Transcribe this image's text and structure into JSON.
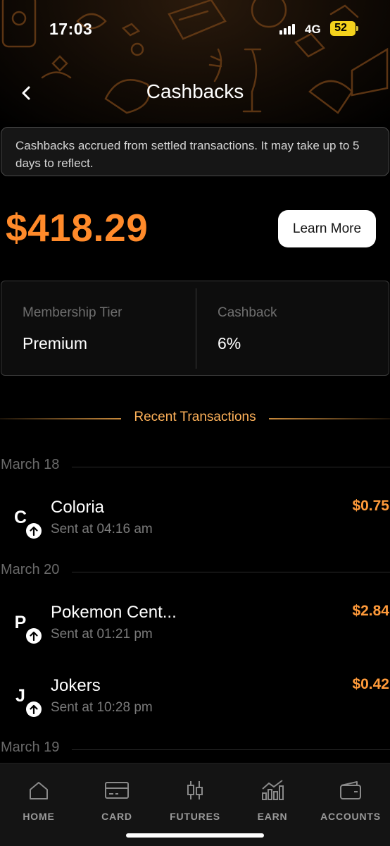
{
  "status": {
    "time": "17:03",
    "network": "4G",
    "battery": "52"
  },
  "header": {
    "title": "Cashbacks"
  },
  "info_message": "Cashbacks accrued from settled transactions. It may take up to 5 days to reflect.",
  "balance": {
    "amount": "$418.29",
    "learn_more_label": "Learn More"
  },
  "membership": {
    "tier_label": "Membership Tier",
    "tier_value": "Premium",
    "cashback_label": "Cashback",
    "cashback_value": "6%"
  },
  "section_title": "Recent Transactions",
  "groups": [
    {
      "date": "March 18",
      "transactions": [
        {
          "letter": "C",
          "name": "Coloria",
          "sub": "Sent at 04:16 am",
          "amount": "$0.75"
        }
      ]
    },
    {
      "date": "March 20",
      "transactions": [
        {
          "letter": "P",
          "name": "Pokemon Cent...",
          "sub": "Sent at 01:21 pm",
          "amount": "$2.84"
        },
        {
          "letter": "J",
          "name": "Jokers",
          "sub": "Sent at 10:28 pm",
          "amount": "$0.42"
        }
      ]
    },
    {
      "date": "March 19",
      "transactions": []
    }
  ],
  "tabs": [
    {
      "label": "HOME",
      "icon": "home-icon"
    },
    {
      "label": "CARD",
      "icon": "card-icon"
    },
    {
      "label": "FUTURES",
      "icon": "candlestick-icon"
    },
    {
      "label": "EARN",
      "icon": "bar-chart-icon"
    },
    {
      "label": "ACCOUNTS",
      "icon": "wallet-icon"
    }
  ],
  "colors": {
    "accent": "#ff8a2a",
    "amount": "#ff9a3a",
    "section_label": "#ffb25a",
    "background": "#000000"
  }
}
